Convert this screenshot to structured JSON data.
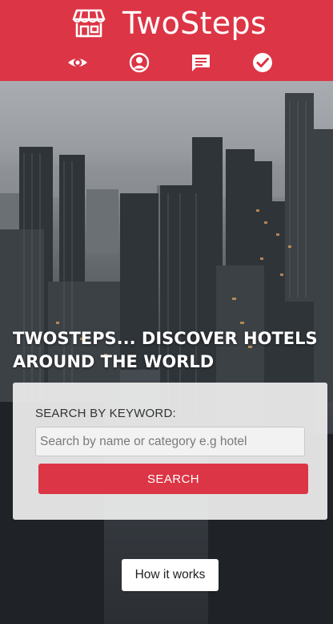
{
  "header": {
    "brand_name": "TwoSteps",
    "brand_icon": "storefront-icon",
    "nav": [
      {
        "id": "view",
        "icon": "eye-icon"
      },
      {
        "id": "account",
        "icon": "user-circle-icon"
      },
      {
        "id": "messages",
        "icon": "message-icon"
      },
      {
        "id": "done",
        "icon": "check-circle-icon"
      }
    ]
  },
  "hero": {
    "headline": "TWOSTEPS... DISCOVER HOTELS AROUND THE WORLD"
  },
  "search": {
    "label": "SEARCH BY KEYWORD:",
    "value": "",
    "placeholder": "Search by name or category e.g hotel",
    "button_label": "SEARCH"
  },
  "how_it_works_label": "How it works",
  "colors": {
    "brand_red": "#dc3545",
    "card_bg": "#eeeeee",
    "text_dark": "#333333"
  }
}
